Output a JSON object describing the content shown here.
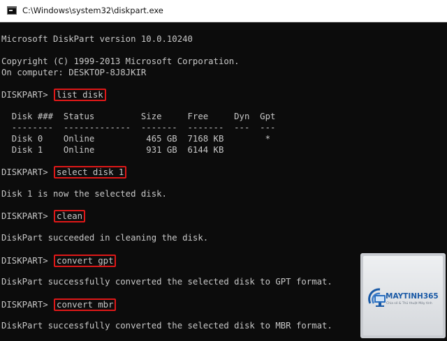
{
  "window": {
    "title": "C:\\Windows\\system32\\diskpart.exe"
  },
  "console": {
    "prompt": "DISKPART> ",
    "lines": {
      "version": "Microsoft DiskPart version 10.0.10240",
      "copyright": "Copyright (C) 1999-2013 Microsoft Corporation.",
      "computer": "On computer: DESKTOP-8J8JKIR",
      "table_header": "  Disk ###  Status         Size     Free     Dyn  Gpt",
      "table_sep": "  --------  -------------  -------  -------  ---  ---",
      "disk0": "  Disk 0    Online          465 GB  7168 KB        *",
      "disk1": "  Disk 1    Online          931 GB  6144 KB",
      "selected_msg": "Disk 1 is now the selected disk.",
      "clean_msg": "DiskPart succeeded in cleaning the disk.",
      "gpt_msg": "DiskPart successfully converted the selected disk to GPT format.",
      "mbr_msg": "DiskPart successfully converted the selected disk to MBR format."
    },
    "commands": {
      "list_disk": "list disk",
      "select_disk": "select disk 1",
      "clean": "clean",
      "convert_gpt": "convert gpt",
      "convert_mbr": "convert mbr"
    },
    "highlight_color": "#e01818",
    "text_color": "#c8c8c8",
    "background_color": "#0c0c0c"
  },
  "watermark": {
    "brand": "MAYTINH365",
    "tagline": "Chia sẻ & Thủ thuật Máy tính",
    "icon": "monitor-wifi-logo-icon"
  }
}
